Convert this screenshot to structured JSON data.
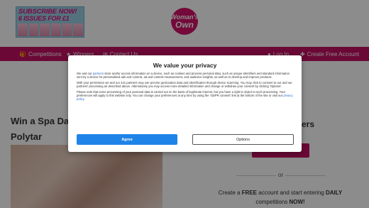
{
  "header": {
    "promo": {
      "line1": "SUBSCRIBE NOW!",
      "line2": "6 ISSUES FOR £1"
    },
    "logo": {
      "line1": "Woman's",
      "line2": "Own"
    }
  },
  "nav": {
    "items": [
      {
        "label": "Competitions",
        "icon": "gift-icon"
      },
      {
        "label": "Winners",
        "icon": "trophy-icon"
      },
      {
        "label": "Contact Us",
        "icon": "mail-icon"
      },
      {
        "label": "Log In",
        "icon": "user-icon"
      },
      {
        "label": "Create Free Account",
        "icon": "user-plus-icon"
      }
    ]
  },
  "article": {
    "title": "Win a Spa Day with Polytar"
  },
  "sidebar": {
    "title": "...ers",
    "or_text": "or",
    "create_prefix": "Create a ",
    "create_free": "FREE",
    "create_middle": " account and start entering ",
    "create_daily": "DAILY",
    "create_suffix": " competitions ",
    "create_now": "NOW!"
  },
  "consent": {
    "title": "We value your privacy",
    "p1_a": "We and our ",
    "p1_link": "partners",
    "p1_b": " store and/or access information on a device, such as cookies and process personal data, such as unique identifiers and standard information sent by a device for personalised ads and content, ad and content measurement, and audience insights, as well as to develop and improve products.",
    "p2": "With your permission we and our 441 partners may use precise geolocation data and identification through device scanning. You may click to consent to our and our partners' processing as described above. Alternatively you may access more detailed information and change or withdraw your consent by clicking 'Options'.",
    "p3_a": "Please note that some processing of your personal data is carried out on the basis of legitimate interest, but you have a right to object to such processing. Your preferences will apply to this website only. You can change your preferences at any time by using the 'GDPR consent' link at the bottom of the site or visit our ",
    "p3_link": "privacy policy",
    "p3_b": ".",
    "agree_label": "Agree",
    "options_label": "Options"
  }
}
